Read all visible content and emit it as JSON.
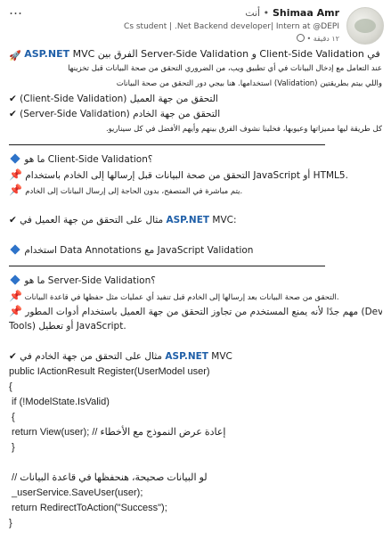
{
  "header": {
    "more": "…",
    "name": "Shimaa Amr",
    "you_label": "• أنت",
    "subtitle": "Cs student | .Net Backend developer| Intern at @DEPI",
    "time": "١٢ دقيقة •"
  },
  "post": {
    "title_mvc": "MVC",
    "title_brand": "ASP.NET",
    "title_rest": "في Client-Side Validation و Server-Side Validation الفرق بين",
    "intro1": "عند التعامل مع إدخال البيانات في أي تطبيق ويب، من الضروري التحقق من صحة البيانات قبل تخزينها",
    "intro2": "واللي بيتم بطريقتين (Validation) استخدامها. هنا بيجي دور التحقق من صحة البيانات",
    "bullet_client": "✔ (Client-Side Validation) التحقق من جهة العميل",
    "bullet_server": "✔ (Server-Side Validation) التحقق من جهة الخادم",
    "intro3": "كل طريقة ليها مميزاتها وعيوبها، فخلينا نشوف الفرق بينهم وأيهم الأفضل في كل سيناريو.",
    "q_client": "ما هو Client-Side Validation؟",
    "client_p1": "التحقق من صحة البيانات قبل إرسالها إلى الخادم باستخدام JavaScript أو HTML5.",
    "client_p2": "يتم مباشرة في المتصفح، بدون الحاجة إلى إرسال البيانات إلى الخادم.",
    "client_example_pre": "✔ مثال على التحقق من جهة العميل في",
    "client_example_brand": "ASP.NET",
    "client_example_post": "MVC:",
    "client_annotations": "استخدام Data Annotations مع JavaScript Validation",
    "q_server": "ما هو Server-Side Validation؟",
    "server_p1": "التحقق من صحة البيانات بعد إرسالها إلى الخادم قبل تنفيذ أي عمليات مثل حفظها في قاعدة البيانات.",
    "server_p2a": "مهم جدًا لأنه يمنع المستخدم من تجاوز التحقق من جهة العميل باستخدام أدوات المطور (Developer",
    "server_p2b": "Tools) أو تعطيل JavaScript.",
    "server_example_pre": "✔ مثال على التحقق من جهة الخادم في",
    "server_example_brand": "ASP.NET",
    "server_example_post": "MVC",
    "code": [
      "public IActionResult Register(UserModel user)",
      "{",
      " if (!ModelState.IsValid)",
      " {",
      " return View(user); // إعادة عرض النموذج مع الأخطاء",
      " }",
      "",
      " // لو البيانات صحيحة، هنحفظها في قاعدة البيانات",
      " _userService.SaveUser(user);",
      " return RedirectToAction(\"Success\");",
      "}"
    ]
  }
}
